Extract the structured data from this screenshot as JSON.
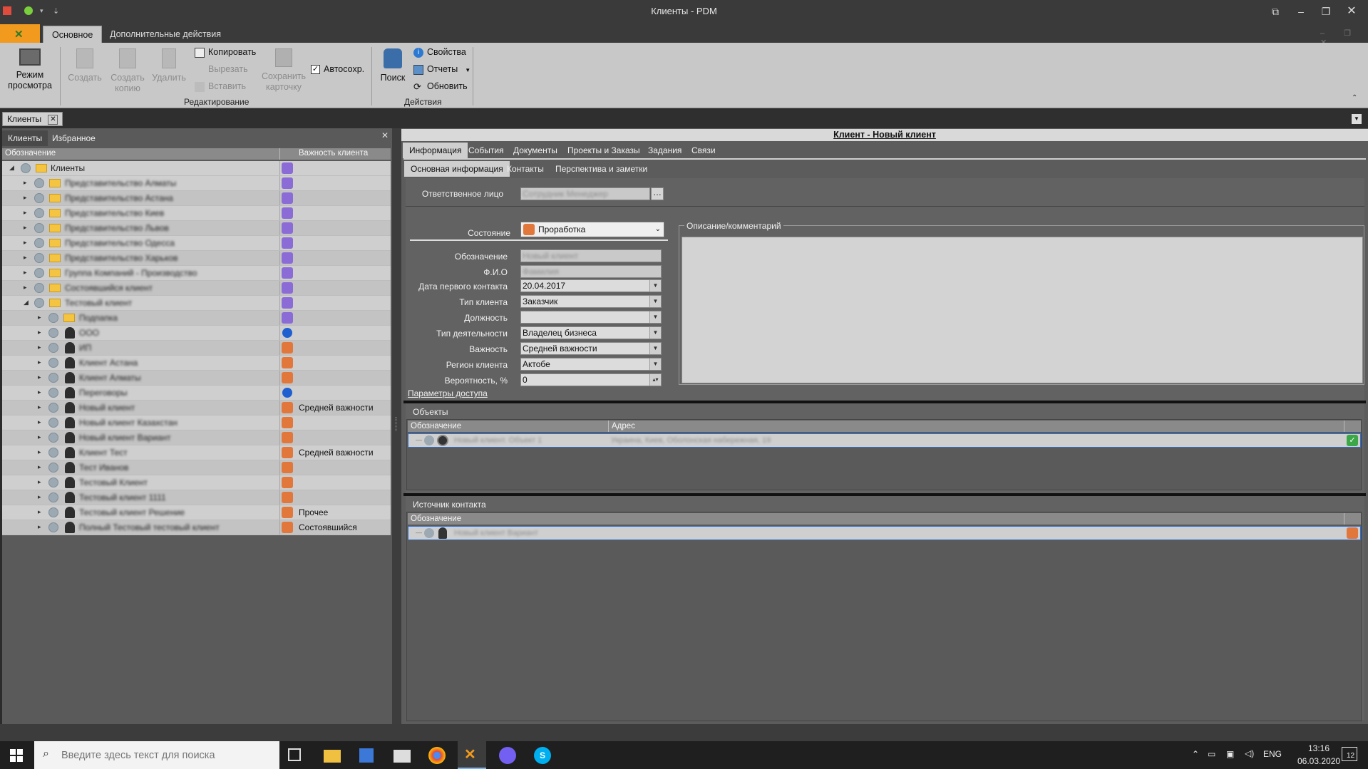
{
  "window": {
    "title": "Клиенты - PDM"
  },
  "ribbon": {
    "tabs": [
      "Основное",
      "Дополнительные действия"
    ],
    "view_mode": "Режим\nпросмотра",
    "create": "Создать",
    "create_copy": "Создать\nкопию",
    "delete": "Удалить",
    "copy": "Копировать",
    "cut": "Вырезать",
    "paste": "Вставить",
    "save_card": "Сохранить\nкарточку",
    "autosave": "Автосохр.",
    "search": "Поиск",
    "properties": "Свойства",
    "reports": "Отчеты",
    "refresh": "Обновить",
    "group_edit": "Редактирование",
    "group_actions": "Действия"
  },
  "doc_tab": {
    "label": "Клиенты"
  },
  "left": {
    "tabs": [
      "Клиенты",
      "Избранное"
    ],
    "col_designation": "Обозначение",
    "col_importance": "Важность клиента",
    "root": "Клиенты",
    "rows": [
      {
        "label": "Представительство Алматы",
        "type": "folder",
        "level": 1,
        "importance": ""
      },
      {
        "label": "Представительство Астана",
        "type": "folder",
        "level": 1,
        "importance": ""
      },
      {
        "label": "Представительство Киев",
        "type": "folder",
        "level": 1,
        "importance": ""
      },
      {
        "label": "Представительство Львов",
        "type": "folder",
        "level": 1,
        "importance": ""
      },
      {
        "label": "Представительство Одесса",
        "type": "folder",
        "level": 1,
        "importance": ""
      },
      {
        "label": "Представительство Харьков",
        "type": "folder",
        "level": 1,
        "importance": ""
      },
      {
        "label": "Группа Компаний - Производство",
        "type": "folder",
        "level": 1,
        "importance": ""
      },
      {
        "label": "Состоявшийся клиент",
        "type": "folder",
        "level": 1,
        "importance": ""
      },
      {
        "label": "Тестовый клиент",
        "type": "folder",
        "level": 1,
        "importance": ""
      },
      {
        "label": "Подпапка",
        "type": "folder",
        "level": 2,
        "importance": ""
      },
      {
        "label": "ООО",
        "type": "person",
        "level": 2,
        "importance": ""
      },
      {
        "label": "ИП",
        "type": "person",
        "level": 2,
        "importance": ""
      },
      {
        "label": "Клиент Астана",
        "type": "person",
        "level": 2,
        "importance": ""
      },
      {
        "label": "Клиент Алматы",
        "type": "person",
        "level": 2,
        "importance": ""
      },
      {
        "label": "Переговоры",
        "type": "person",
        "level": 2,
        "importance": ""
      },
      {
        "label": "Новый клиент",
        "type": "person",
        "level": 2,
        "importance": "Средней важности"
      },
      {
        "label": "Новый клиент Казахстан",
        "type": "person",
        "level": 2,
        "importance": ""
      },
      {
        "label": "Новый клиент Вариант",
        "type": "person",
        "level": 2,
        "importance": ""
      },
      {
        "label": "Клиент Тест",
        "type": "person",
        "level": 2,
        "importance": "Средней важности"
      },
      {
        "label": "Тест Иванов",
        "type": "person",
        "level": 2,
        "importance": ""
      },
      {
        "label": "Тестовый Клиент",
        "type": "person",
        "level": 2,
        "importance": ""
      },
      {
        "label": "Тестовый клиент 1111",
        "type": "person",
        "level": 2,
        "importance": ""
      },
      {
        "label": "Тестовый клиент Решение",
        "type": "person",
        "level": 2,
        "importance": "Прочее"
      },
      {
        "label": "Полный Тестовый тестовый клиент",
        "type": "person",
        "level": 2,
        "importance": "Состоявшийся"
      }
    ]
  },
  "card": {
    "title": "Клиент - Новый клиент",
    "tabs": [
      "Информация",
      "События",
      "Документы",
      "Проекты и Заказы",
      "Задания",
      "Связи"
    ],
    "subtabs": [
      "Основная информация",
      "Контакты",
      "Перспектива и заметки"
    ],
    "responsible_label": "Ответственное лицо",
    "responsible_value": "Сотрудник Менеджер",
    "state_label": "Состояние",
    "state_value": "Проработка",
    "description_label": "Описание/комментарий",
    "fields": [
      {
        "label": "Обозначение",
        "value": "Новый клиент",
        "blurred": true,
        "dropdown": false
      },
      {
        "label": "Ф.И.О",
        "value": "Фамилия",
        "blurred": true,
        "dropdown": false
      },
      {
        "label": "Дата первого контакта",
        "value": "20.04.2017",
        "blurred": false,
        "dropdown": true
      },
      {
        "label": "Тип клиента",
        "value": "Заказчик",
        "blurred": false,
        "dropdown": true
      },
      {
        "label": "Должность",
        "value": "",
        "blurred": false,
        "dropdown": true
      },
      {
        "label": "Тип деятельности",
        "value": "Владелец бизнеса",
        "blurred": false,
        "dropdown": true
      },
      {
        "label": "Важность",
        "value": "Средней важности",
        "blurred": false,
        "dropdown": true
      },
      {
        "label": "Регион клиента",
        "value": "Актобе",
        "blurred": false,
        "dropdown": true
      },
      {
        "label": "Вероятность, %",
        "value": "0",
        "blurred": false,
        "dropdown": true
      }
    ],
    "access_link": "Параметры доступа",
    "objects": {
      "title": "Объекты",
      "col_designation": "Обозначение",
      "col_address": "Адрес",
      "row_designation": "Новый клиент. Объект 1",
      "row_address": "Украина, Киев, Оболонская набережная, 19"
    },
    "source": {
      "title": "Источник контакта",
      "col_designation": "Обозначение",
      "row_designation": "Новый клиент Вариант"
    }
  },
  "taskbar": {
    "search_placeholder": "Введите здесь текст для поиска",
    "lang": "ENG",
    "time": "13:16",
    "date": "06.03.2020",
    "notif_count": "12"
  },
  "colors": {
    "accent": "#f29a1d",
    "selection": "#2b6fd6",
    "status_orange": "#e2773c"
  }
}
